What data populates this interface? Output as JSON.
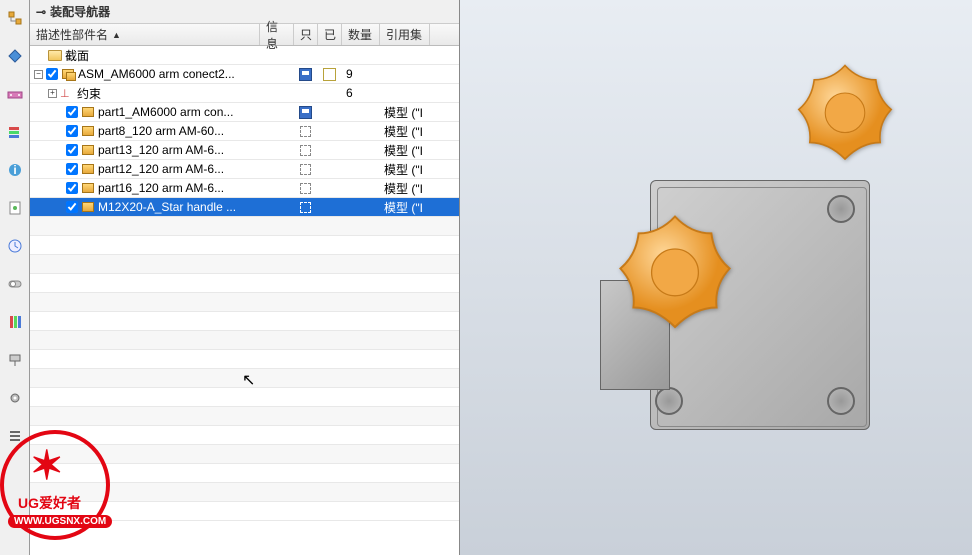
{
  "panel": {
    "title": "装配导航器"
  },
  "columns": {
    "name": "描述性部件名",
    "info": "信息",
    "only": "只",
    "done": "已",
    "qty": "数量",
    "ref": "引用集"
  },
  "toolbar_icons": [
    "assembly-tree-icon",
    "constraint-icon",
    "component-icon",
    "layers-icon",
    "info-blue-icon",
    "sheet-icon",
    "clock-icon",
    "toggle-icon",
    "spectrum-icon",
    "roller-icon",
    "gear-icon",
    "list-icon"
  ],
  "tree": {
    "section_label": "截面",
    "root": {
      "label": "ASM_AM6000 arm conect2...",
      "qty": "9",
      "constraints": {
        "label": "约束",
        "qty": "6"
      },
      "children": [
        {
          "label": "part1_AM6000 arm con...",
          "ref": "模型 (\"I",
          "save": true
        },
        {
          "label": "part8_120 arm AM-60...",
          "ref": "模型 (\"I"
        },
        {
          "label": "part13_120 arm AM-6...",
          "ref": "模型 (\"I"
        },
        {
          "label": "part12_120 arm AM-6...",
          "ref": "模型 (\"I"
        },
        {
          "label": "part16_120 arm AM-6...",
          "ref": "模型 (\"I"
        },
        {
          "label": "M12X20-A_Star handle ...",
          "ref": "模型 (\"I",
          "selected": true
        }
      ]
    }
  },
  "watermark": {
    "text1": "UG爱好者",
    "text2": "WWW.UGSNX.COM"
  },
  "chart_data": null
}
